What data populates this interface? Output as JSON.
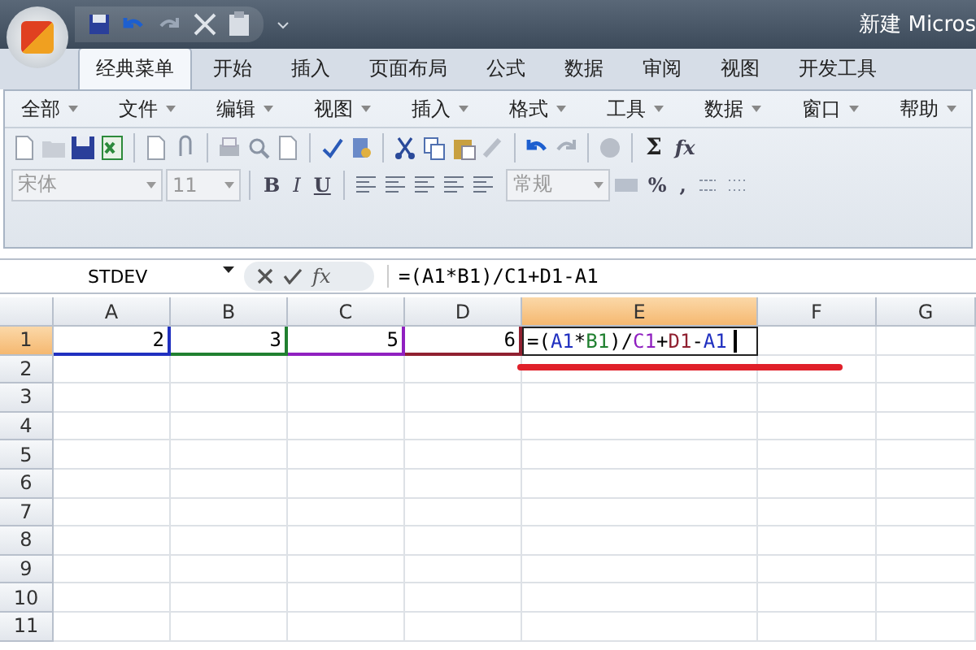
{
  "window": {
    "title": "新建 Micros"
  },
  "tabs": [
    {
      "label": "经典菜单",
      "selected": true
    },
    {
      "label": "开始",
      "selected": false
    },
    {
      "label": "插入",
      "selected": false
    },
    {
      "label": "页面布局",
      "selected": false
    },
    {
      "label": "公式",
      "selected": false
    },
    {
      "label": "数据",
      "selected": false
    },
    {
      "label": "审阅",
      "selected": false
    },
    {
      "label": "视图",
      "selected": false
    },
    {
      "label": "开发工具",
      "selected": false
    }
  ],
  "menus": [
    "全部",
    "文件",
    "编辑",
    "视图",
    "插入",
    "格式",
    "工具",
    "数据",
    "窗口",
    "帮助"
  ],
  "toolbar": {
    "font": "宋体",
    "font_size": "11",
    "style_buttons": [
      "B",
      "I",
      "U"
    ],
    "number_format": "常规",
    "number_buttons": [
      "%",
      ","
    ],
    "sum": "Σ",
    "function": "fx"
  },
  "formula_bar": {
    "name_box": "STDEV",
    "fx": "fx",
    "formula": "=(A1*B1)/C1+D1-A1"
  },
  "sheet": {
    "columns": [
      {
        "label": "A",
        "selected": false
      },
      {
        "label": "B",
        "selected": false
      },
      {
        "label": "C",
        "selected": false
      },
      {
        "label": "D",
        "selected": false
      },
      {
        "label": "E",
        "selected": true
      },
      {
        "label": "F",
        "selected": false
      },
      {
        "label": "G",
        "selected": false
      }
    ],
    "rows": [
      {
        "label": "1",
        "selected": true
      },
      {
        "label": "2",
        "selected": false
      },
      {
        "label": "3",
        "selected": false
      },
      {
        "label": "4",
        "selected": false
      },
      {
        "label": "5",
        "selected": false
      },
      {
        "label": "6",
        "selected": false
      },
      {
        "label": "7",
        "selected": false
      },
      {
        "label": "8",
        "selected": false
      },
      {
        "label": "9",
        "selected": false
      },
      {
        "label": "10",
        "selected": false
      },
      {
        "label": "11",
        "selected": false
      }
    ],
    "cells": [
      {
        "value": "2",
        "color": "#2030c0"
      },
      {
        "value": "3",
        "color": "#208030"
      },
      {
        "value": "5",
        "color": "#9020c0"
      },
      {
        "value": "6",
        "color": "#902030"
      }
    ],
    "editing_cell": [
      {
        "text": "=("
      },
      {
        "text": "A1",
        "color": "#2030c0"
      },
      {
        "text": "*"
      },
      {
        "text": "B1",
        "color": "#208030"
      },
      {
        "text": ")/"
      },
      {
        "text": "C1",
        "color": "#9020c0"
      },
      {
        "text": "+"
      },
      {
        "text": "D1",
        "color": "#902030"
      },
      {
        "text": "-"
      },
      {
        "text": "A1",
        "color": "#2030c0"
      }
    ]
  }
}
